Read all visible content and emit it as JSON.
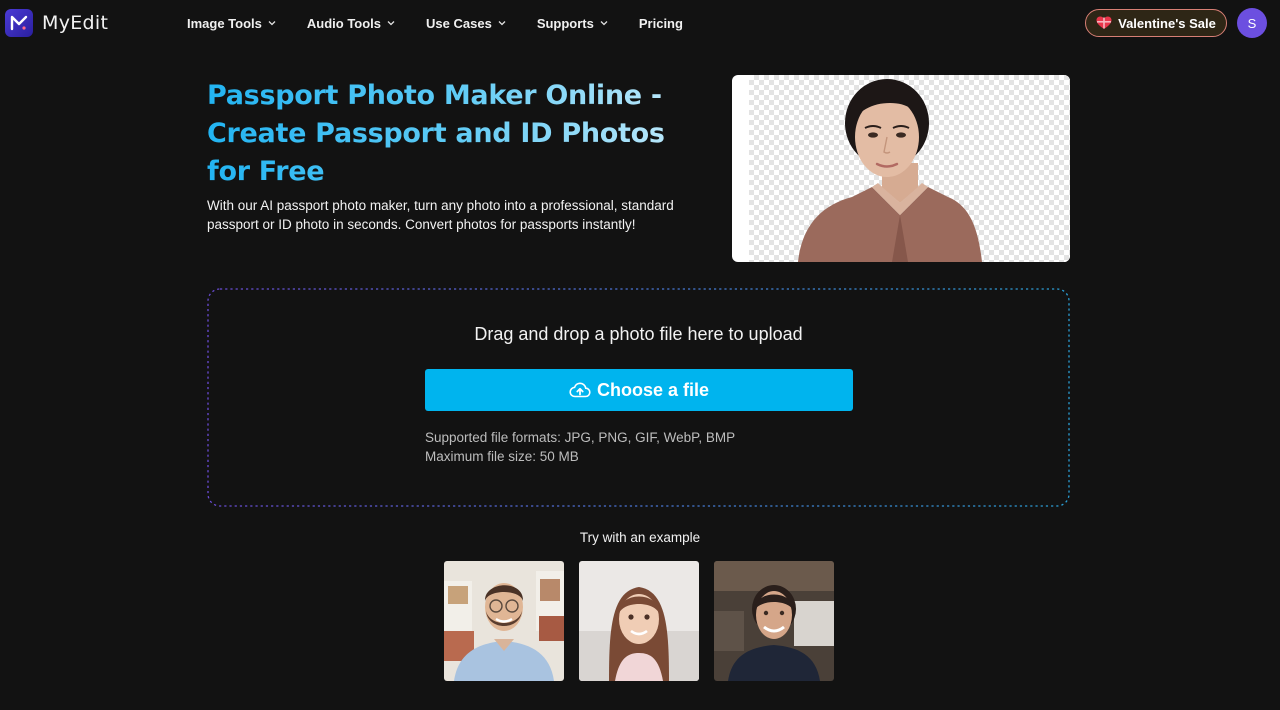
{
  "header": {
    "brand": "MyEdit",
    "nav": [
      {
        "label": "Image Tools",
        "has_dropdown": true
      },
      {
        "label": "Audio Tools",
        "has_dropdown": true
      },
      {
        "label": "Use Cases",
        "has_dropdown": true
      },
      {
        "label": "Supports",
        "has_dropdown": true
      },
      {
        "label": "Pricing",
        "has_dropdown": false
      }
    ],
    "sale_button": {
      "label": "Valentine's Sale",
      "icon": "heart-gift-icon"
    },
    "avatar_initial": "S"
  },
  "hero": {
    "title": "Passport Photo Maker Online - Create Passport and ID Photos for Free",
    "description": "With our AI passport photo maker, turn any photo into a professional, standard passport or ID photo in seconds. Convert photos for passports instantly!",
    "image_alt": "Woman portrait with transparent background"
  },
  "upload": {
    "hint": "Drag and drop a photo file here to upload",
    "button_label": "Choose a file",
    "button_icon": "cloud-upload-icon",
    "formats_line": "Supported file formats: JPG, PNG, GIF, WebP, BMP",
    "size_line": "Maximum file size: 50 MB"
  },
  "examples": {
    "label": "Try with an example",
    "items": [
      {
        "alt": "Smiling man with glasses"
      },
      {
        "alt": "Smiling girl with long hair"
      },
      {
        "alt": "Smiling woman in dark shirt"
      }
    ]
  },
  "colors": {
    "background": "#121212",
    "accent_blue": "#00b4ee",
    "title_gradient_start": "#22b4f2",
    "avatar": "#6c4fe0",
    "border_purple": "#6a4bd6",
    "border_blue": "#2a9fd6"
  }
}
